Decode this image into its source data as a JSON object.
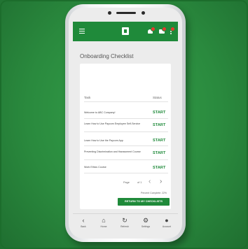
{
  "page_title": "Onboarding Checklist",
  "table": {
    "col_task": "Task",
    "col_status": "Status",
    "rows": [
      {
        "task": "Welcome to ABC Company!",
        "status": "START"
      },
      {
        "task": "Learn How to Use Paycom Employee Self-Service",
        "status": "START"
      },
      {
        "task": "Learn How to Use the Paycom App",
        "status": "START"
      },
      {
        "task": "Preventing Discrimination and Harassment Course",
        "status": "START"
      },
      {
        "task": "Work Ethics Course",
        "status": "START"
      }
    ]
  },
  "pager": {
    "page_label": "Page",
    "of_label": "of 1"
  },
  "percent_complete": "Percent Complete: 22%",
  "return_button": "RETURN TO MY CHECKLISTS",
  "tabbar": [
    {
      "icon": "back-icon",
      "glyph": "‹",
      "label": "Back"
    },
    {
      "icon": "home-icon",
      "glyph": "⌂",
      "label": "Home"
    },
    {
      "icon": "refresh-icon",
      "glyph": "↻",
      "label": "Refresh"
    },
    {
      "icon": "gear-icon",
      "glyph": "⚙",
      "label": "Settings"
    },
    {
      "icon": "account-icon",
      "glyph": "●",
      "label": "Account"
    }
  ],
  "colors": {
    "brand": "#1f8a3a",
    "background": "#2a8a3e",
    "badge": "#e23a2f"
  }
}
